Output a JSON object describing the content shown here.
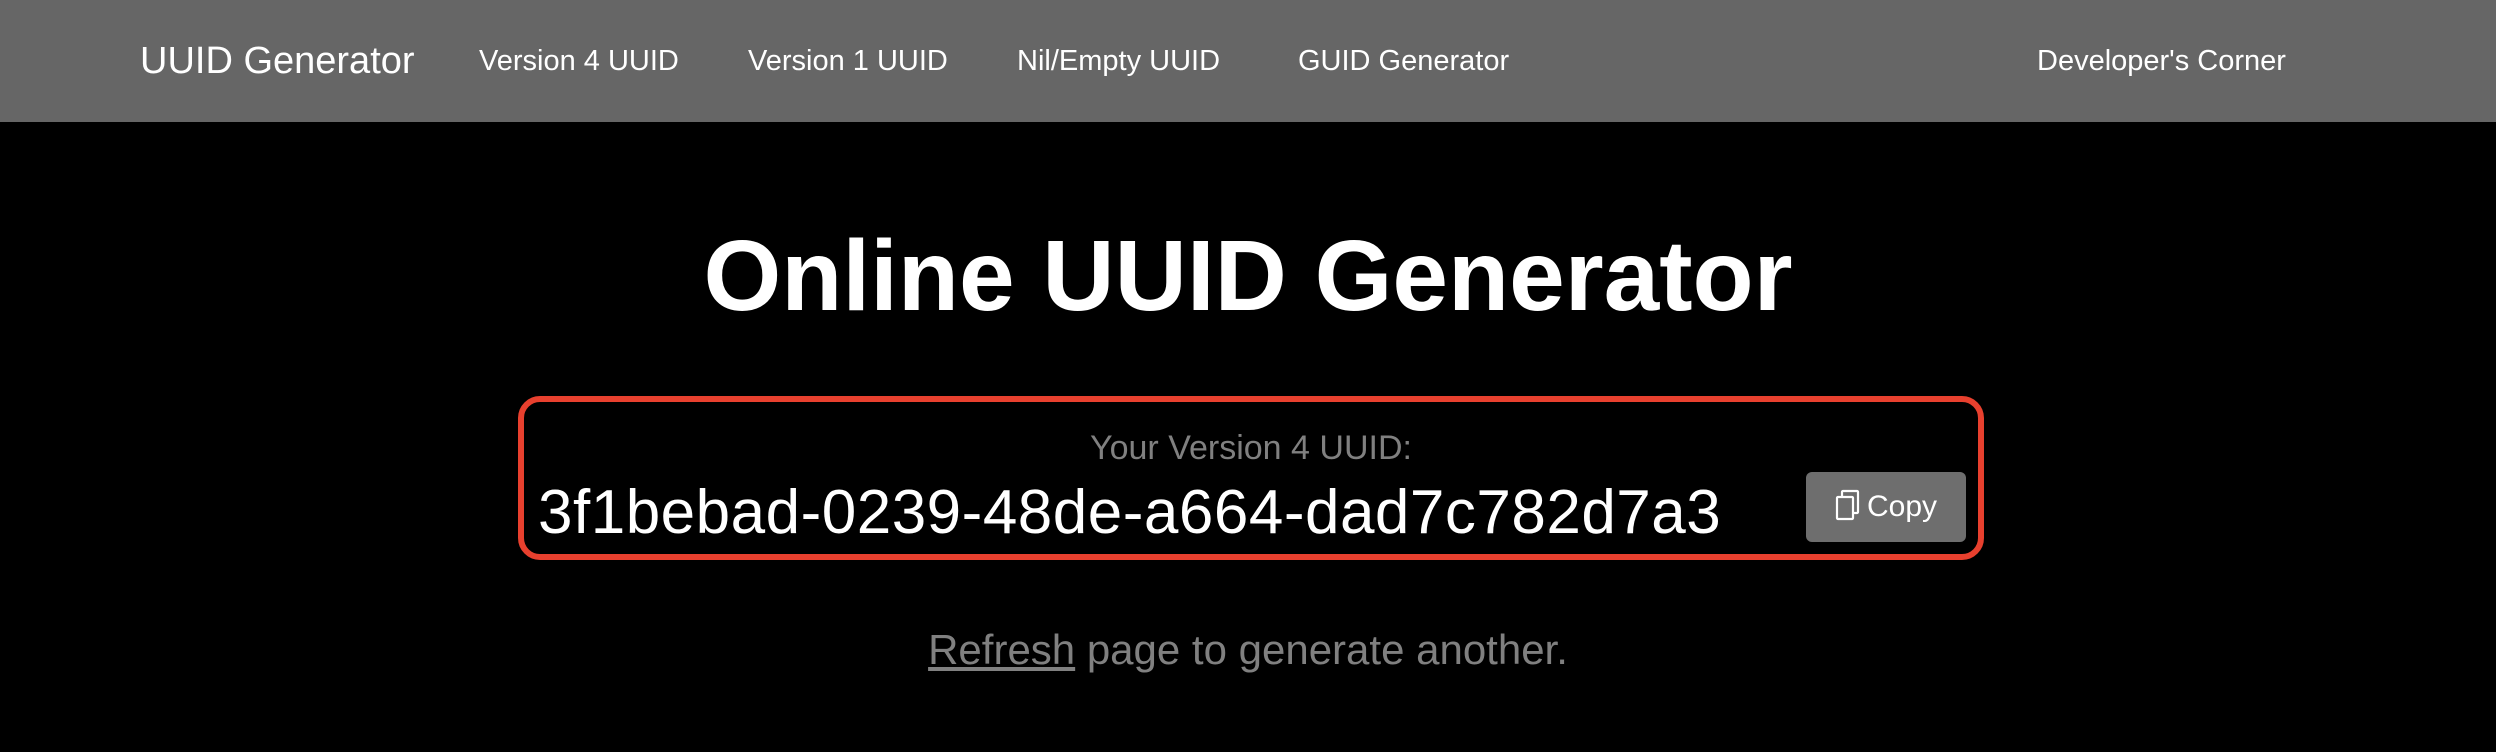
{
  "navbar": {
    "brand": "UUID Generator",
    "links": [
      {
        "label": "Version 4 UUID"
      },
      {
        "label": "Version 1 UUID"
      },
      {
        "label": "Nil/Empty UUID"
      },
      {
        "label": "GUID Generator"
      }
    ],
    "right_link": "Developer's Corner",
    "background_color": "#666666"
  },
  "main": {
    "title": "Online UUID Generator",
    "uuid_label": "Your Version 4 UUID:",
    "uuid_value": "3f1bebad-0239-48de-a664-dad7c782d7a3",
    "copy_button": {
      "label": "Copy",
      "icon": "copy-icon"
    },
    "highlight_color": "#e8402e",
    "refresh": {
      "link_text": "Refresh",
      "suffix_text": " page to generate another."
    }
  }
}
